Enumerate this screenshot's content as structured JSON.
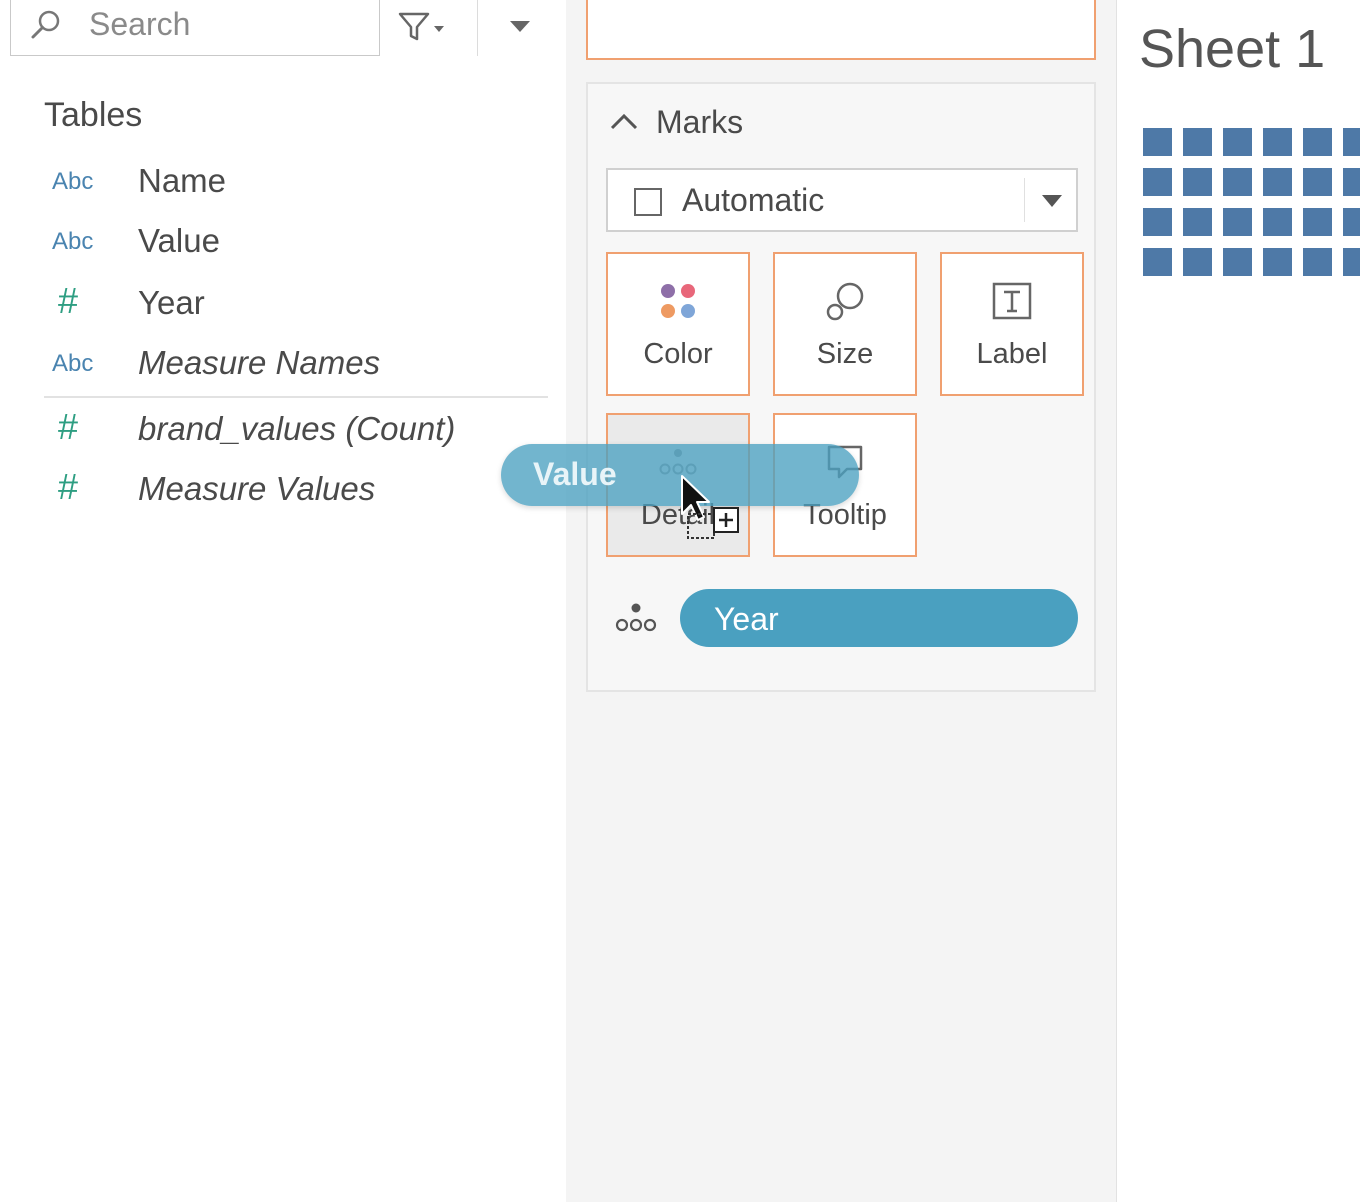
{
  "data_pane": {
    "search": {
      "placeholder": "Search"
    },
    "tables_heading": "Tables",
    "fields": [
      {
        "type": "Abc",
        "name": "Name",
        "italic": false
      },
      {
        "type": "Abc",
        "name": "Value",
        "italic": false
      },
      {
        "type": "#",
        "name": "Year",
        "italic": false
      },
      {
        "type": "Abc",
        "name": "Measure Names",
        "italic": true
      },
      {
        "type": "#",
        "name": "brand_values (Count)",
        "italic": true
      },
      {
        "type": "#",
        "name": "Measure Values",
        "italic": true
      }
    ]
  },
  "marks": {
    "title": "Marks",
    "mark_type": "Automatic",
    "buttons": {
      "color": "Color",
      "size": "Size",
      "label": "Label",
      "detail": "Detail",
      "tooltip": "Tooltip"
    },
    "detail_pill": "Year"
  },
  "drag": {
    "pill_label": "Value"
  },
  "view": {
    "sheet_title": "Sheet 1"
  },
  "colors": {
    "pill_blue": "#4aa0c0",
    "shelf_orange": "#f0a070",
    "mark_blue": "#4e79a7",
    "field_type_abc": "#4a84b0",
    "field_type_hash": "#2e9e82"
  }
}
